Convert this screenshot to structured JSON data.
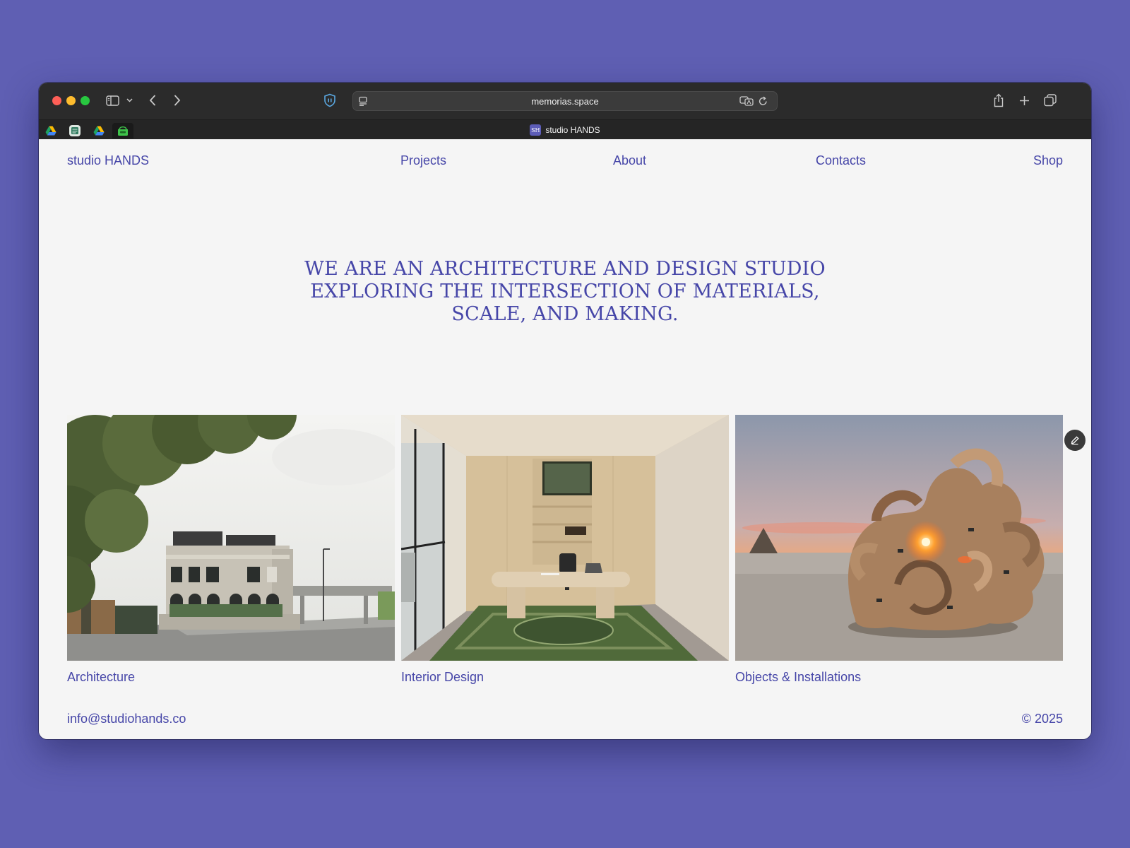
{
  "browser": {
    "url": "memorias.space",
    "tab_title": "studio HANDS",
    "tab_favicon_text": "SH",
    "favorites": [
      {
        "icon": "google-drive-icon"
      },
      {
        "icon": "notebook-icon"
      },
      {
        "icon": "google-drive-icon"
      },
      {
        "icon": "green-box-icon"
      }
    ]
  },
  "site": {
    "logo": "studio HANDS",
    "nav": {
      "projects": "Projects",
      "about": "About",
      "contacts": "Contacts",
      "shop": "Shop"
    },
    "hero_lines": [
      "WE ARE AN ARCHITECTURE AND DESIGN STUDIO",
      "EXPLORING THE INTERSECTION OF MATERIALS,",
      "SCALE, AND MAKING."
    ],
    "cards": [
      {
        "caption": "Architecture"
      },
      {
        "caption": "Interior Design"
      },
      {
        "caption": "Objects & Installations"
      }
    ],
    "footer": {
      "email": "info@studiohands.co",
      "copyright": "© 2025"
    }
  },
  "colors": {
    "background": "#5f5fb3",
    "brand": "#4646a8",
    "page": "#f5f5f5",
    "toolbar": "#2b2b2b"
  }
}
